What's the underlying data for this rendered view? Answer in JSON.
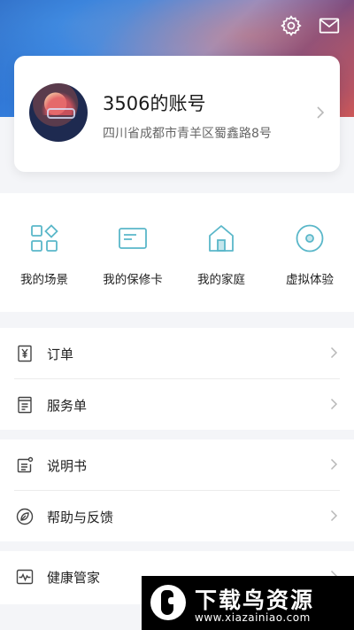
{
  "profile": {
    "account_name": "3506的账号",
    "address": "四川省成都市青羊区蜀鑫路8号"
  },
  "shortcuts": [
    {
      "label": "我的场景",
      "icon": "scene-grid-icon"
    },
    {
      "label": "我的保修卡",
      "icon": "warranty-card-icon"
    },
    {
      "label": "我的家庭",
      "icon": "home-icon"
    },
    {
      "label": "虚拟体验",
      "icon": "virtual-disc-icon"
    }
  ],
  "menu_groups": [
    {
      "items": [
        {
          "label": "订单",
          "icon": "order-yen-icon"
        },
        {
          "label": "服务单",
          "icon": "service-list-icon"
        }
      ]
    },
    {
      "items": [
        {
          "label": "说明书",
          "icon": "manual-icon"
        },
        {
          "label": "帮助与反馈",
          "icon": "help-leaf-icon"
        }
      ]
    },
    {
      "items": [
        {
          "label": "健康管家",
          "icon": "health-pulse-icon"
        }
      ]
    }
  ],
  "watermark": {
    "title": "下载鸟资源",
    "subtitle": "www.xiazainiao.com"
  },
  "colors": {
    "accent_icon": "#5ab7c9",
    "text_primary": "#222222",
    "text_secondary": "#666666",
    "chevron": "#b8b8b8"
  }
}
